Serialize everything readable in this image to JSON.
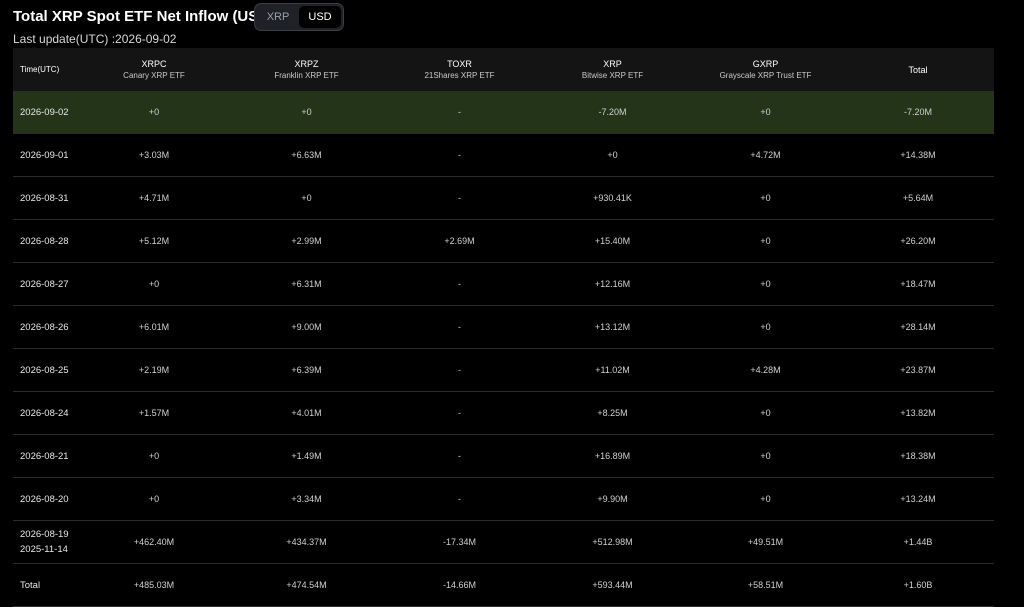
{
  "header": {
    "title": "Total XRP Spot ETF Net Inflow (USD)",
    "last_update": "Last update(UTC) :2026-09-02",
    "toggle": {
      "options": [
        "XRP",
        "USD"
      ],
      "selected": "USD"
    }
  },
  "table": {
    "time_header": "Time(UTC)",
    "columns": [
      {
        "ticker": "XRPC",
        "name": "Canary XRP ETF"
      },
      {
        "ticker": "XRPZ",
        "name": "Franklin XRP ETF"
      },
      {
        "ticker": "TOXR",
        "name": "21Shares XRP ETF"
      },
      {
        "ticker": "XRP",
        "name": "Bitwise XRP ETF"
      },
      {
        "ticker": "GXRP",
        "name": "Grayscale XRP Trust ETF"
      },
      {
        "ticker": "Total",
        "name": ""
      }
    ],
    "rows": [
      {
        "date": [
          "2026-09-02"
        ],
        "values": [
          "+0",
          "+0",
          "-",
          "-7.20M",
          "+0",
          "-7.20M"
        ],
        "highlight": true
      },
      {
        "date": [
          "2026-09-01"
        ],
        "values": [
          "+3.03M",
          "+6.63M",
          "-",
          "+0",
          "+4.72M",
          "+14.38M"
        ]
      },
      {
        "date": [
          "2026-08-31"
        ],
        "values": [
          "+4.71M",
          "+0",
          "-",
          "+930.41K",
          "+0",
          "+5.64M"
        ]
      },
      {
        "date": [
          "2026-08-28"
        ],
        "values": [
          "+5.12M",
          "+2.99M",
          "+2.69M",
          "+15.40M",
          "+0",
          "+26.20M"
        ]
      },
      {
        "date": [
          "2026-08-27"
        ],
        "values": [
          "+0",
          "+6.31M",
          "-",
          "+12.16M",
          "+0",
          "+18.47M"
        ]
      },
      {
        "date": [
          "2026-08-26"
        ],
        "values": [
          "+6.01M",
          "+9.00M",
          "-",
          "+13.12M",
          "+0",
          "+28.14M"
        ]
      },
      {
        "date": [
          "2026-08-25"
        ],
        "values": [
          "+2.19M",
          "+6.39M",
          "-",
          "+11.02M",
          "+4.28M",
          "+23.87M"
        ]
      },
      {
        "date": [
          "2026-08-24"
        ],
        "values": [
          "+1.57M",
          "+4.01M",
          "-",
          "+8.25M",
          "+0",
          "+13.82M"
        ]
      },
      {
        "date": [
          "2026-08-21"
        ],
        "values": [
          "+0",
          "+1.49M",
          "-",
          "+16.89M",
          "+0",
          "+18.38M"
        ]
      },
      {
        "date": [
          "2026-08-20"
        ],
        "values": [
          "+0",
          "+3.34M",
          "-",
          "+9.90M",
          "+0",
          "+13.24M"
        ]
      },
      {
        "date": [
          "2026-08-19",
          "2025-11-14"
        ],
        "values": [
          "+462.40M",
          "+434.37M",
          "-17.34M",
          "+512.98M",
          "+49.51M",
          "+1.44B"
        ]
      },
      {
        "date": [
          "Total"
        ],
        "values": [
          "+485.03M",
          "+474.54M",
          "-14.66M",
          "+593.44M",
          "+58.51M",
          "+1.60B"
        ]
      }
    ]
  },
  "colors": {
    "positive": "#5ab38c",
    "negative": "#e05555",
    "highlight_row": "#243419",
    "background": "#000000"
  }
}
